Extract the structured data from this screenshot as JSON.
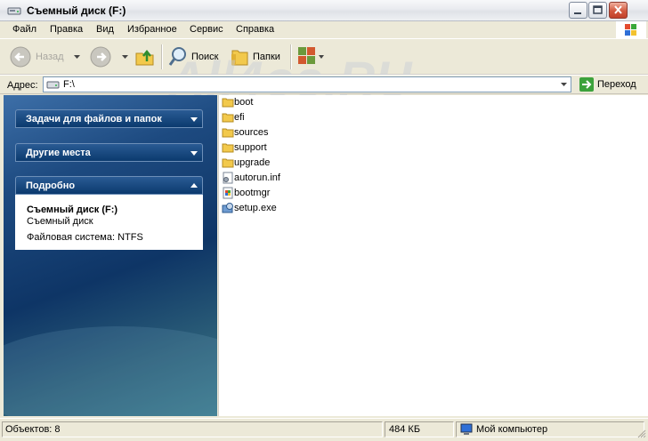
{
  "window": {
    "title": "Съемный диск (F:)"
  },
  "menu": [
    "Файл",
    "Правка",
    "Вид",
    "Избранное",
    "Сервис",
    "Справка"
  ],
  "toolbar": {
    "back": "Назад",
    "search": "Поиск",
    "folders": "Папки"
  },
  "address": {
    "label": "Адрес:",
    "value": "F:\\",
    "go": "Переход"
  },
  "watermark": "All4os.RU",
  "sidebar": {
    "tasks": "Задачи для файлов и папок",
    "places": "Другие места",
    "details": {
      "title": "Подробно",
      "name": "Съемный диск (F:)",
      "type": "Съемный диск",
      "fs": "Файловая система: NTFS"
    }
  },
  "files": [
    {
      "name": "boot",
      "icon": "folder-icon"
    },
    {
      "name": "efi",
      "icon": "folder-icon"
    },
    {
      "name": "sources",
      "icon": "folder-icon"
    },
    {
      "name": "support",
      "icon": "folder-icon"
    },
    {
      "name": "upgrade",
      "icon": "folder-icon"
    },
    {
      "name": "autorun.inf",
      "icon": "settings-file-icon"
    },
    {
      "name": "bootmgr",
      "icon": "system-file-icon"
    },
    {
      "name": "setup.exe",
      "icon": "setup-exe-icon"
    }
  ],
  "status": {
    "objects": "Объектов: 8",
    "size": "484 КБ",
    "location": "Мой компьютер"
  },
  "colors": {
    "accent": "#0b3a6e",
    "folder": "#f2c94c"
  }
}
